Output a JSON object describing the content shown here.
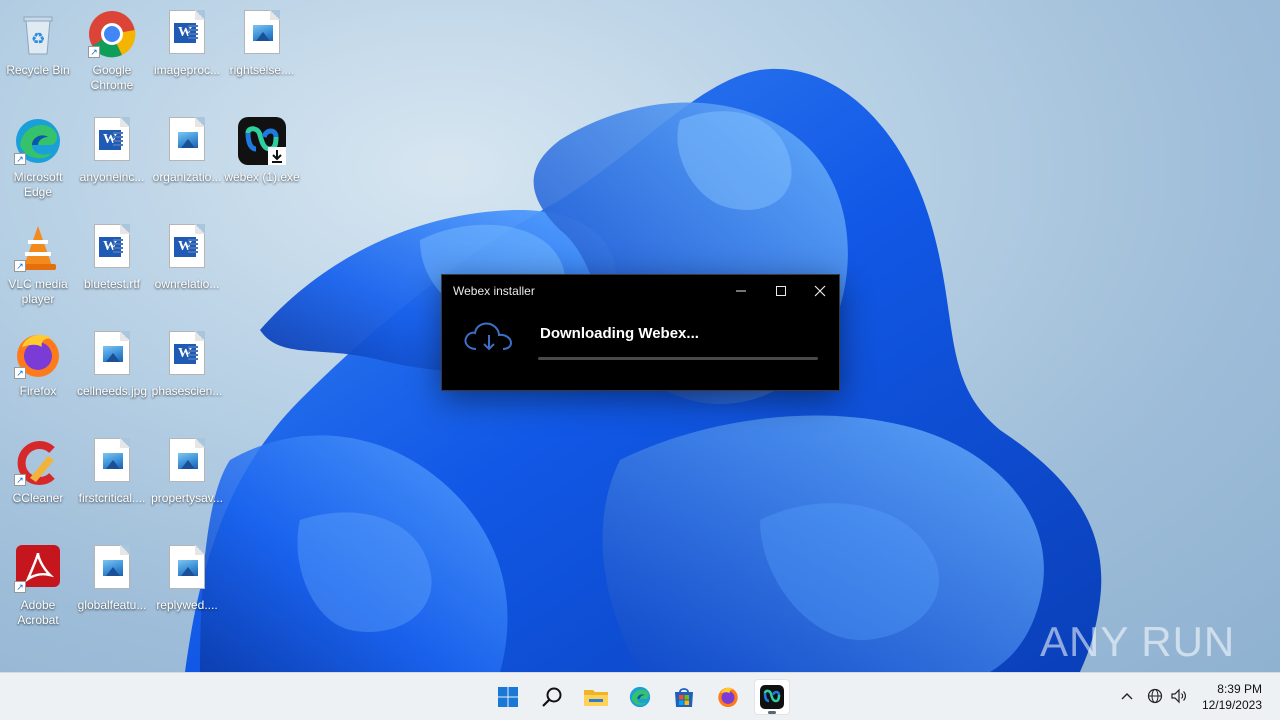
{
  "desktop": {
    "icons": [
      {
        "label": "Recycle Bin",
        "icon": "recycle-bin-icon"
      },
      {
        "label": "Google Chrome",
        "icon": "chrome-icon"
      },
      {
        "label": "imageproc...",
        "icon": "word-document-icon"
      },
      {
        "label": "rightselse....",
        "icon": "image-file-icon"
      },
      {
        "label": "Microsoft Edge",
        "icon": "edge-icon"
      },
      {
        "label": "anyoneinc...",
        "icon": "word-document-icon"
      },
      {
        "label": "organizatio...",
        "icon": "image-file-icon"
      },
      {
        "label": "webex (1).exe",
        "icon": "webex-installer-icon"
      },
      {
        "label": "VLC media player",
        "icon": "vlc-icon"
      },
      {
        "label": "bluetest.rtf",
        "icon": "word-document-icon"
      },
      {
        "label": "ownrelatio...",
        "icon": "word-document-icon"
      },
      {
        "label": "Firefox",
        "icon": "firefox-icon"
      },
      {
        "label": "cellneeds.jpg",
        "icon": "image-file-icon"
      },
      {
        "label": "phasescien...",
        "icon": "word-document-icon"
      },
      {
        "label": "CCleaner",
        "icon": "ccleaner-icon"
      },
      {
        "label": "firstcritical....",
        "icon": "image-file-icon"
      },
      {
        "label": "propertysav...",
        "icon": "image-file-icon"
      },
      {
        "label": "Adobe Acrobat",
        "icon": "acrobat-icon"
      },
      {
        "label": "globalfeatu...",
        "icon": "image-file-icon"
      },
      {
        "label": "replywed....",
        "icon": "image-file-icon"
      }
    ]
  },
  "dialog": {
    "title": "Webex installer",
    "message": "Downloading Webex...",
    "progress": 0,
    "icon": "cloud-download-icon"
  },
  "watermark": {
    "text": "ANY RUN"
  },
  "taskbar": {
    "pinned": [
      "start-icon",
      "search-icon",
      "file-explorer-icon",
      "edge-icon",
      "store-icon",
      "firefox-icon",
      "webex-icon"
    ],
    "active": "webex-icon"
  },
  "tray": {
    "time": "8:39 PM",
    "date": "12/19/2023"
  },
  "colors": {
    "dialog_bg": "#000000",
    "taskbar_bg": "#eef1f4",
    "accent_blue": "#1d6fd8"
  }
}
